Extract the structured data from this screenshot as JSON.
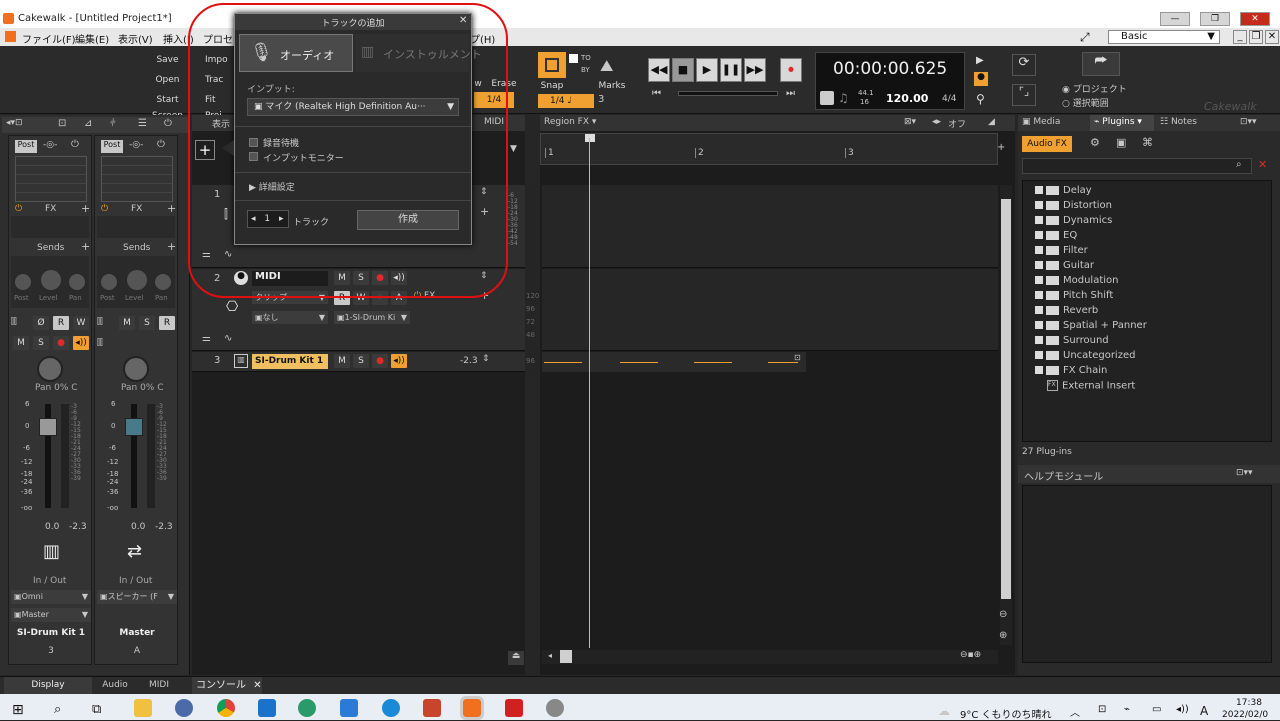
{
  "window": {
    "title": "Cakewalk - [Untitled Project1*]"
  },
  "menu": [
    "ファイル(F)",
    "編集(E)",
    "表示(V)",
    "挿入(I)",
    "プロセス",
    "プ(H)"
  ],
  "workspace": {
    "label": "Basic"
  },
  "toolbar": {
    "save": "Save",
    "open": "Open",
    "start_screen": "Start Screen",
    "import": "Impo",
    "track": "Trac",
    "fit_proj": "Fit Proj",
    "view_label": "w",
    "erase": "Erase",
    "snap": "Snap",
    "marks": "Marks",
    "snap_value": "1/4",
    "snap_note": "1/4",
    "marks_value": "3",
    "to_label": "TO",
    "by_label": "BY"
  },
  "transport": {
    "time": "00:00:00.625",
    "tempo": "120.00",
    "meter": "4/4",
    "sample_rate": "44.1",
    "bit_depth": "16",
    "range_project": "プロジェクト",
    "range_selection": "選択範囲",
    "brand": "Cakewalk"
  },
  "track_view": {
    "menu_view": "表示",
    "midi": "MIDI",
    "region_fx": "Region FX",
    "off": "オフ",
    "ruler": [
      "1",
      "2",
      "3"
    ]
  },
  "tracks": [
    {
      "number": "1"
    },
    {
      "number": "2",
      "name": "MIDI",
      "clip_label": "クリップ",
      "output": "なし",
      "fx": "FX",
      "inst": "1-SI-Drum Ki"
    },
    {
      "number": "3",
      "name": "SI-Drum Kit 1",
      "volume": "-2.3"
    }
  ],
  "track_buttons": {
    "mute": "M",
    "solo": "S",
    "write": "W",
    "read": "R",
    "phase": "Ø",
    "arm_rec": "R",
    "auto": "A"
  },
  "meter_scale_track": [
    "-6",
    "-12",
    "-18",
    "-24",
    "-30",
    "-36",
    "-42",
    "-48",
    "-54"
  ],
  "velocity_scale": [
    "120",
    "96",
    "72",
    "48",
    "96"
  ],
  "console": {
    "strips": [
      {
        "post": "Post",
        "fx": "FX",
        "sends": "Sends",
        "pan": "Pan 0% C",
        "vol": "0.0",
        "peak": "-2.3",
        "inout": "In / Out",
        "input": "Omni",
        "output": "Master",
        "name": "SI-Drum Kit 1",
        "num": "3",
        "icon": "piano-icon"
      },
      {
        "post": "Post",
        "fx": "FX",
        "sends": "Sends",
        "pan": "Pan 0% C",
        "vol": "0.0",
        "peak": "-2.3",
        "inout": "In / Out",
        "input": "スピーカー (F",
        "name": "Master",
        "num": "A",
        "icon": "arrows-icon"
      }
    ],
    "level_labels": [
      "Post",
      "Level",
      "Pan"
    ],
    "fader_left_scale": [
      "6",
      "0",
      "-6",
      "-12",
      "-18",
      "-24",
      "-36",
      "-oo"
    ],
    "fader_right_scale": [
      "-3",
      "-6",
      "-9",
      "-12",
      "-15",
      "-18",
      "-21",
      "-24",
      "-27",
      "-30",
      "-33",
      "-36",
      "-39"
    ]
  },
  "add_track_dialog": {
    "title": "トラックの追加",
    "tab_audio": "オーディオ",
    "tab_instrument": "インストゥルメント",
    "input_label": "インプット:",
    "input_value": "マイク (Realtek High Definition Au···",
    "record_standby": "録音待機",
    "input_monitor": "インプットモニター",
    "advanced": "詳細設定",
    "count": "1",
    "track_label": "トラック",
    "create": "作成"
  },
  "browser": {
    "tabs": [
      "Media",
      "Plugins",
      "Notes"
    ],
    "audio_fx_tab": "Audio FX",
    "plugins": [
      "Delay",
      "Distortion",
      "Dynamics",
      "EQ",
      "Filter",
      "Guitar",
      "Modulation",
      "Pitch Shift",
      "Reverb",
      "Spatial + Panner",
      "Surround",
      "Uncategorized",
      "FX Chain"
    ],
    "external_insert": "External Insert",
    "count": "27 Plug-ins"
  },
  "help_module": {
    "title": "ヘルプモジュール"
  },
  "bottom_tabs": {
    "display": "Display",
    "audio": "Audio",
    "midi": "MIDI",
    "console_tab": "コンソール"
  },
  "taskbar": {
    "weather": "9°C くもりのち晴れ",
    "time": "17:38",
    "date": "2022/02/0",
    "ime": "A"
  },
  "colors": {
    "accent": "#f0a030",
    "record": "#e02a2a",
    "highlight_circle": "#e01010"
  }
}
